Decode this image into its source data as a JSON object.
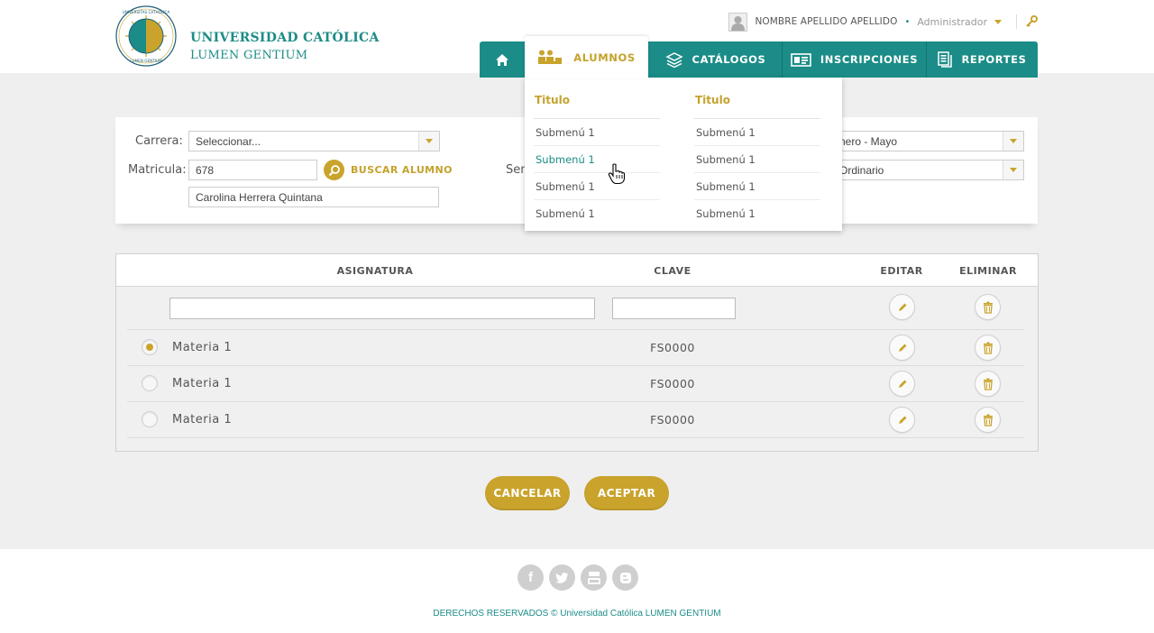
{
  "header": {
    "university_line1": "UNIVERSIDAD CATÓLICA",
    "university_line2": "LUMEN GENTIUM",
    "seal_text": "UNIVERSITAS CATHOLICA LUMEN GENTIUM",
    "user_name": "NOMBRE APELLIDO APELLIDO",
    "separator": "•",
    "role": "Administrador"
  },
  "nav": {
    "items": [
      {
        "label": "",
        "icon": "home-icon"
      },
      {
        "label": "ALUMNOS",
        "icon": "students-icon",
        "active": true
      },
      {
        "label": "CATÁLOGOS",
        "icon": "books-icon"
      },
      {
        "label": "INSCRIPCIONES",
        "icon": "id-card-icon"
      },
      {
        "label": "REPORTES",
        "icon": "report-icon"
      }
    ]
  },
  "dropdown": {
    "columns": [
      {
        "title": "Titulo",
        "items": [
          "Submenú 1",
          "Submenú 1",
          "Submenú 1",
          "Submenú 1"
        ]
      },
      {
        "title": "Titulo",
        "items": [
          "Submenú 1",
          "Submenú 1",
          "Submenú 1",
          "Submenú 1"
        ]
      }
    ]
  },
  "filters": {
    "carrera_label": "Carrera:",
    "carrera_value": "Seleccionar...",
    "matricula_label": "Matricula:",
    "matricula_value": "678",
    "search_label": "BUSCAR ALUMNO",
    "student_name": "Carolina Herrera Quintana",
    "semestre_label_partial": "Sem",
    "periodo_value": "nero - Mayo",
    "tipo_value": "Ordinario"
  },
  "table": {
    "headers": {
      "asignatura": "ASIGNATURA",
      "clave": "CLAVE",
      "editar": "EDITAR",
      "eliminar": "ELIMINAR"
    },
    "rows": [
      {
        "name": "Materia 1",
        "key": "FS0000",
        "selected": true
      },
      {
        "name": "Materia 1",
        "key": "FS0000",
        "selected": false
      },
      {
        "name": "Materia 1",
        "key": "FS0000",
        "selected": false
      }
    ]
  },
  "actions": {
    "cancel": "CANCELAR",
    "accept": "ACEPTAR"
  },
  "footer": {
    "social": [
      "facebook-icon",
      "twitter-icon",
      "youtube-icon",
      "blogger-icon"
    ],
    "copyright": "DERECHOS RESERVADOS © Universidad Católica LUMEN GENTIUM"
  },
  "colors": {
    "teal": "#1b8c87",
    "gold": "#c9a32b",
    "background": "#efefef"
  }
}
